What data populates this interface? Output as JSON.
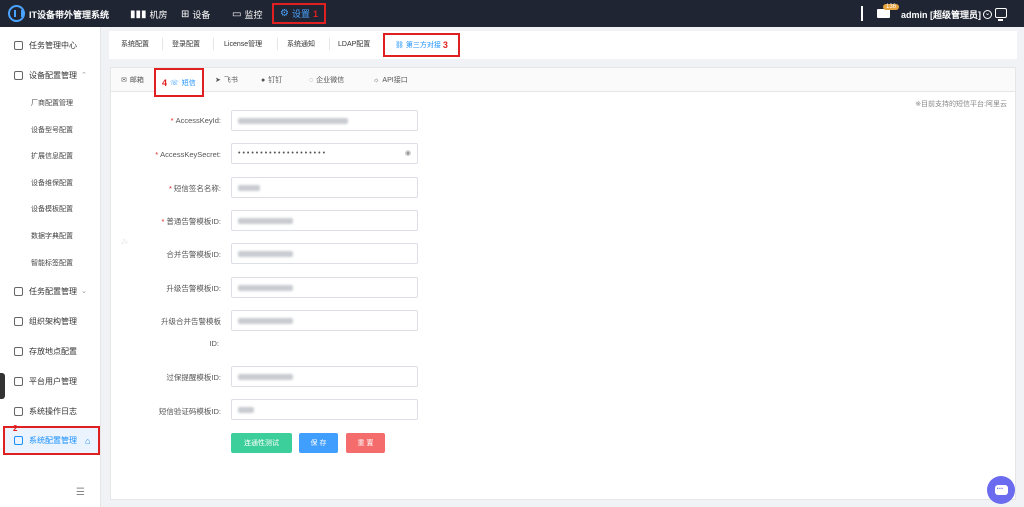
{
  "app": {
    "title": "IT设备带外管理系统"
  },
  "topnav": [
    {
      "label": "机房",
      "icon": "bar-chart-icon"
    },
    {
      "label": "设备",
      "icon": "grid-icon"
    },
    {
      "label": "监控",
      "icon": "monitor-icon"
    },
    {
      "label": "设置",
      "icon": "gear-icon",
      "active": true,
      "step": "1"
    }
  ],
  "header": {
    "mail_badge": "136",
    "user": "admin [超级管理员]"
  },
  "sidebar": {
    "items": [
      {
        "label": "任务管理中心"
      },
      {
        "label": "设备配置管理"
      },
      {
        "label": "厂商配置管理"
      },
      {
        "label": "设备型号配置"
      },
      {
        "label": "扩展信息配置"
      },
      {
        "label": "设备维保配置"
      },
      {
        "label": "设备模板配置"
      },
      {
        "label": "数据字典配置"
      },
      {
        "label": "智能标签配置"
      },
      {
        "label": "任务配置管理"
      },
      {
        "label": "组织架构管理"
      },
      {
        "label": "存放地点配置"
      },
      {
        "label": "平台用户管理"
      },
      {
        "label": "系统操作日志"
      },
      {
        "label": "系统配置管理",
        "active": true,
        "step": "2"
      }
    ]
  },
  "tabs": [
    {
      "label": "系统配置"
    },
    {
      "label": "登录配置"
    },
    {
      "label": "License管理"
    },
    {
      "label": "系统通知"
    },
    {
      "label": "LDAP配置"
    },
    {
      "label": "第三方对接",
      "active": true,
      "step": "3"
    }
  ],
  "subtabs": [
    {
      "label": "邮箱",
      "icon": "mail-icon"
    },
    {
      "label": "短信",
      "icon": "sms-icon",
      "active": true,
      "step": "4"
    },
    {
      "label": "飞书",
      "icon": "send-icon"
    },
    {
      "label": "钉钉",
      "icon": "dingtalk-icon"
    },
    {
      "label": "企业微信",
      "icon": "chat-icon"
    },
    {
      "label": "API接口",
      "icon": "bulb-icon"
    }
  ],
  "note": "※目前支持的短信平台:阿里云",
  "form": {
    "fields": [
      {
        "label": "AccessKeyId:",
        "required": true,
        "value": ""
      },
      {
        "label": "AccessKeySecret:",
        "required": true,
        "value": "••••••••••••••••••••"
      },
      {
        "label": "短信签名名称:",
        "required": true,
        "value": ""
      },
      {
        "label": "普通告警模板ID:",
        "required": true,
        "value": ""
      },
      {
        "label": "合并告警模板ID:",
        "required": false,
        "value": ""
      },
      {
        "label": "升级告警模板ID:",
        "required": false,
        "value": ""
      },
      {
        "label": "升级合并告警模板",
        "label2": "ID:",
        "required": false,
        "value": ""
      },
      {
        "label": "过保提醒模板ID:",
        "required": false,
        "value": ""
      },
      {
        "label": "短信验证码模板ID:",
        "required": false,
        "value": ""
      }
    ],
    "buttons": [
      {
        "label": "连通性测试",
        "color": "#3ccf9b"
      },
      {
        "label": "保 存",
        "color": "#409eff"
      },
      {
        "label": "重 置",
        "color": "#f56c6c"
      }
    ]
  },
  "colors": {
    "accent": "#1890ff",
    "highlight": "#e02020",
    "topbar": "#1f2532"
  }
}
